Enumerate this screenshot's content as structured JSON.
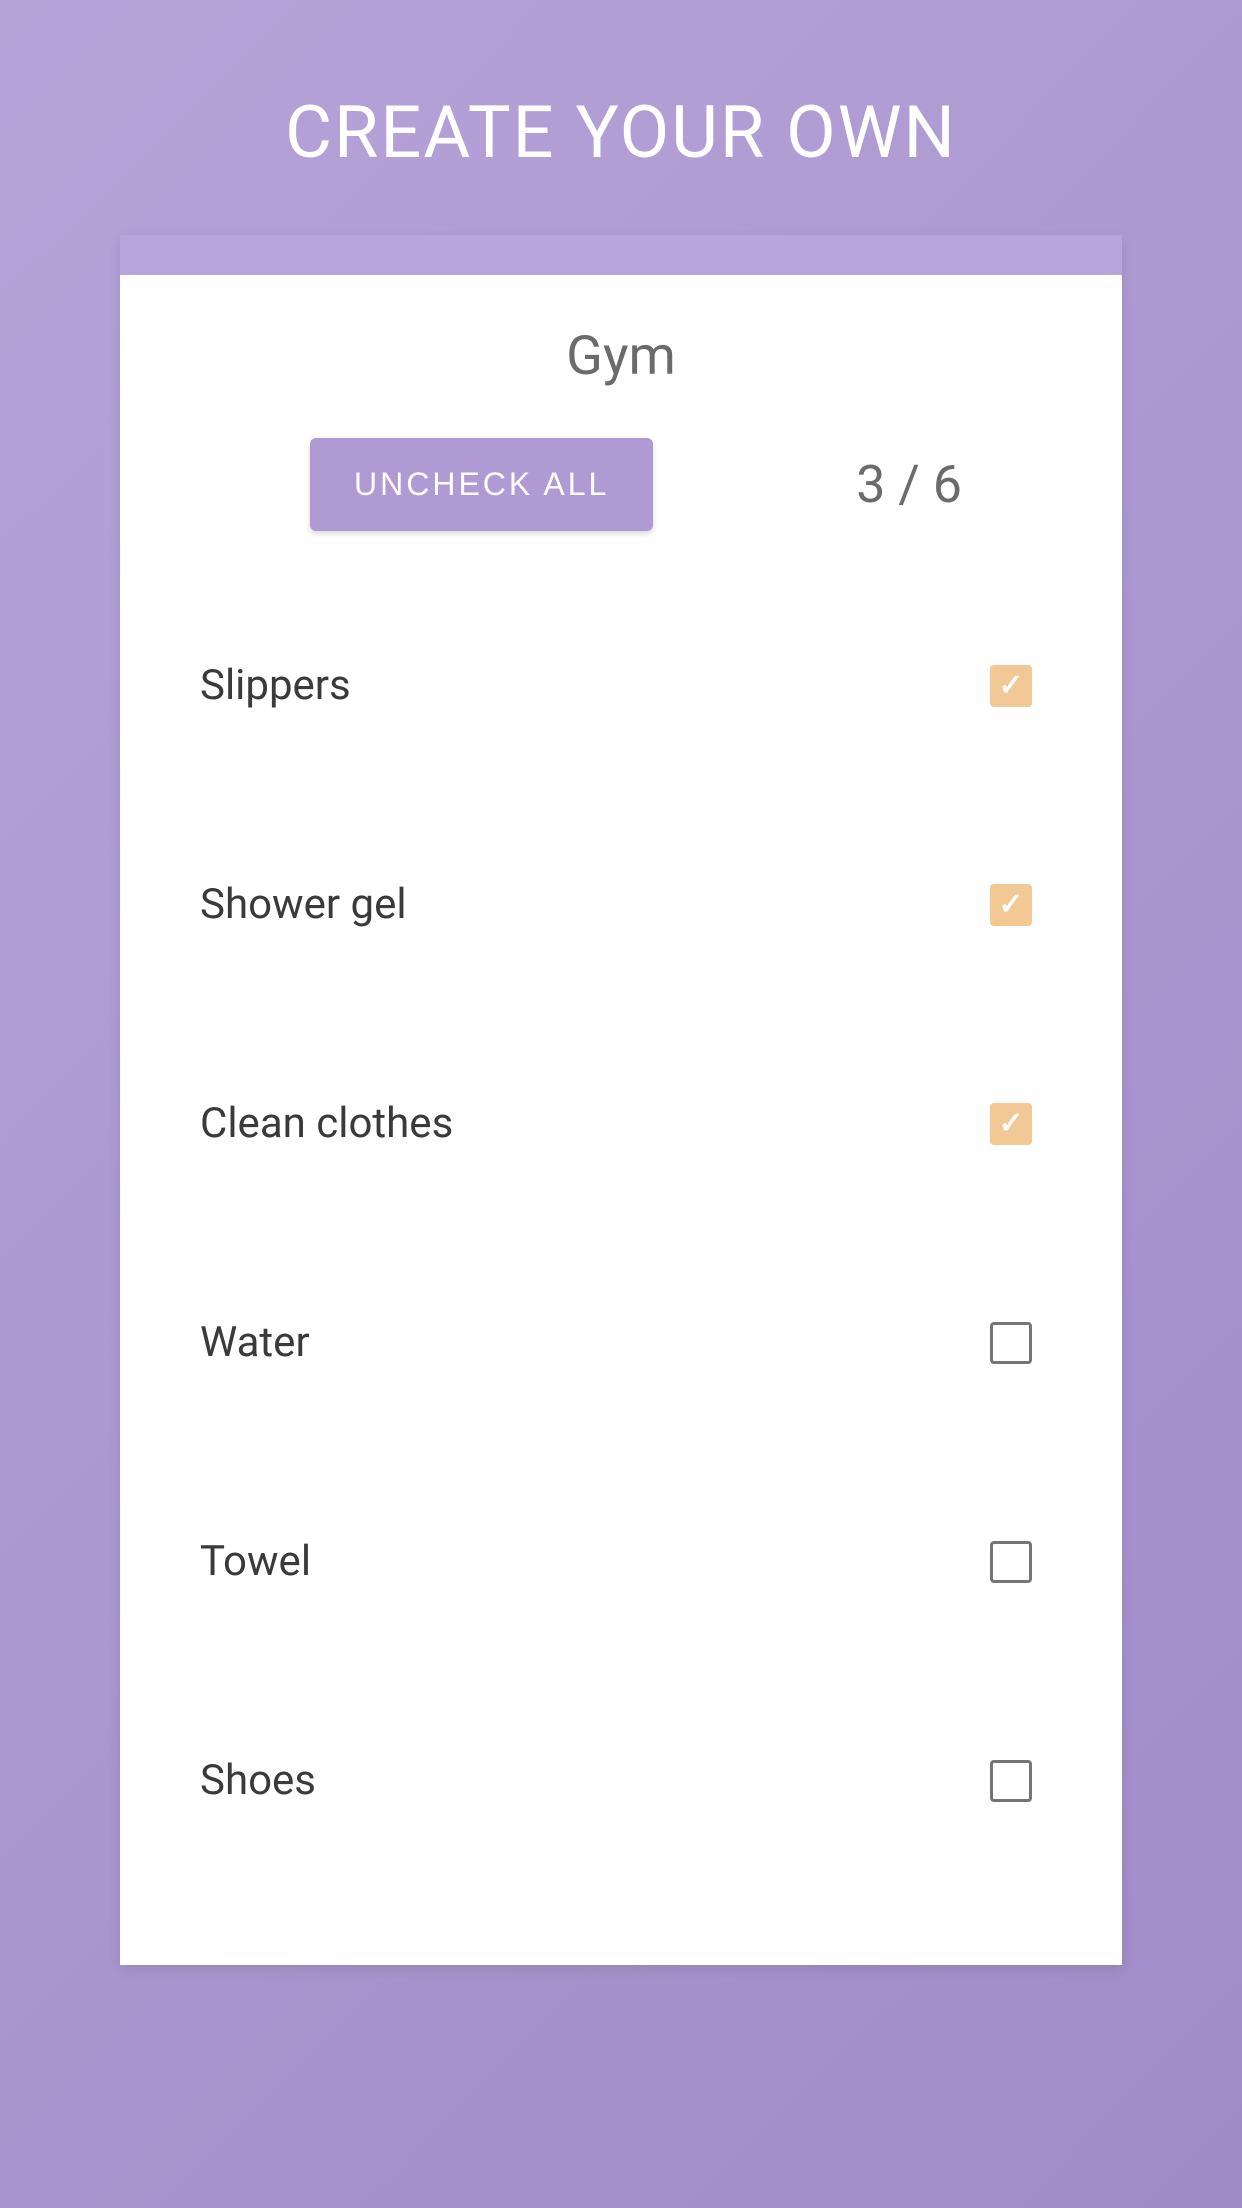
{
  "header": {
    "title": "CREATE YOUR OWN"
  },
  "card": {
    "title": "Gym",
    "uncheck_button_label": "UNCHECK ALL",
    "counter": "3 / 6"
  },
  "items": [
    {
      "label": "Slippers",
      "checked": true
    },
    {
      "label": "Shower gel",
      "checked": true
    },
    {
      "label": "Clean clothes",
      "checked": true
    },
    {
      "label": "Water",
      "checked": false
    },
    {
      "label": "Towel",
      "checked": false
    },
    {
      "label": "Shoes",
      "checked": false
    }
  ]
}
